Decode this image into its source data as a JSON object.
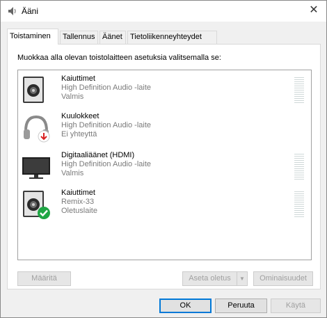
{
  "window": {
    "title": "Ääni",
    "close_glyph": "✕"
  },
  "tabs": [
    {
      "label": "Toistaminen",
      "active": true
    },
    {
      "label": "Tallennus",
      "active": false
    },
    {
      "label": "Äänet",
      "active": false
    },
    {
      "label": "Tietoliikenneyhteydet",
      "active": false
    }
  ],
  "panel": {
    "instruction": "Muokkaa alla olevan toistolaitteen asetuksia valitsemalla se:"
  },
  "devices": [
    {
      "name": "Kaiuttimet",
      "desc": "High Definition Audio -laite",
      "status": "Valmis",
      "icon": "speaker-icon",
      "meter": true
    },
    {
      "name": "Kuulokkeet",
      "desc": "High Definition Audio -laite",
      "status": "Ei yhteyttä",
      "icon": "headphones-disconnected-icon",
      "meter": false
    },
    {
      "name": "Digitaaliäänet (HDMI)",
      "desc": "High Definition Audio -laite",
      "status": "Valmis",
      "icon": "monitor-icon",
      "meter": true
    },
    {
      "name": "Kaiuttimet",
      "desc": "Remix-33",
      "status": "Oletuslaite",
      "icon": "speaker-default-icon",
      "meter": true
    }
  ],
  "panel_buttons": {
    "configure": "Määritä",
    "set_default": "Aseta oletus",
    "properties": "Ominaisuudet"
  },
  "dialog_buttons": {
    "ok": "OK",
    "cancel": "Peruuta",
    "apply": "Käytä"
  },
  "colors": {
    "accent": "#0078d7",
    "default_check": "#1ea644",
    "disconnect_arrow": "#d92020"
  }
}
